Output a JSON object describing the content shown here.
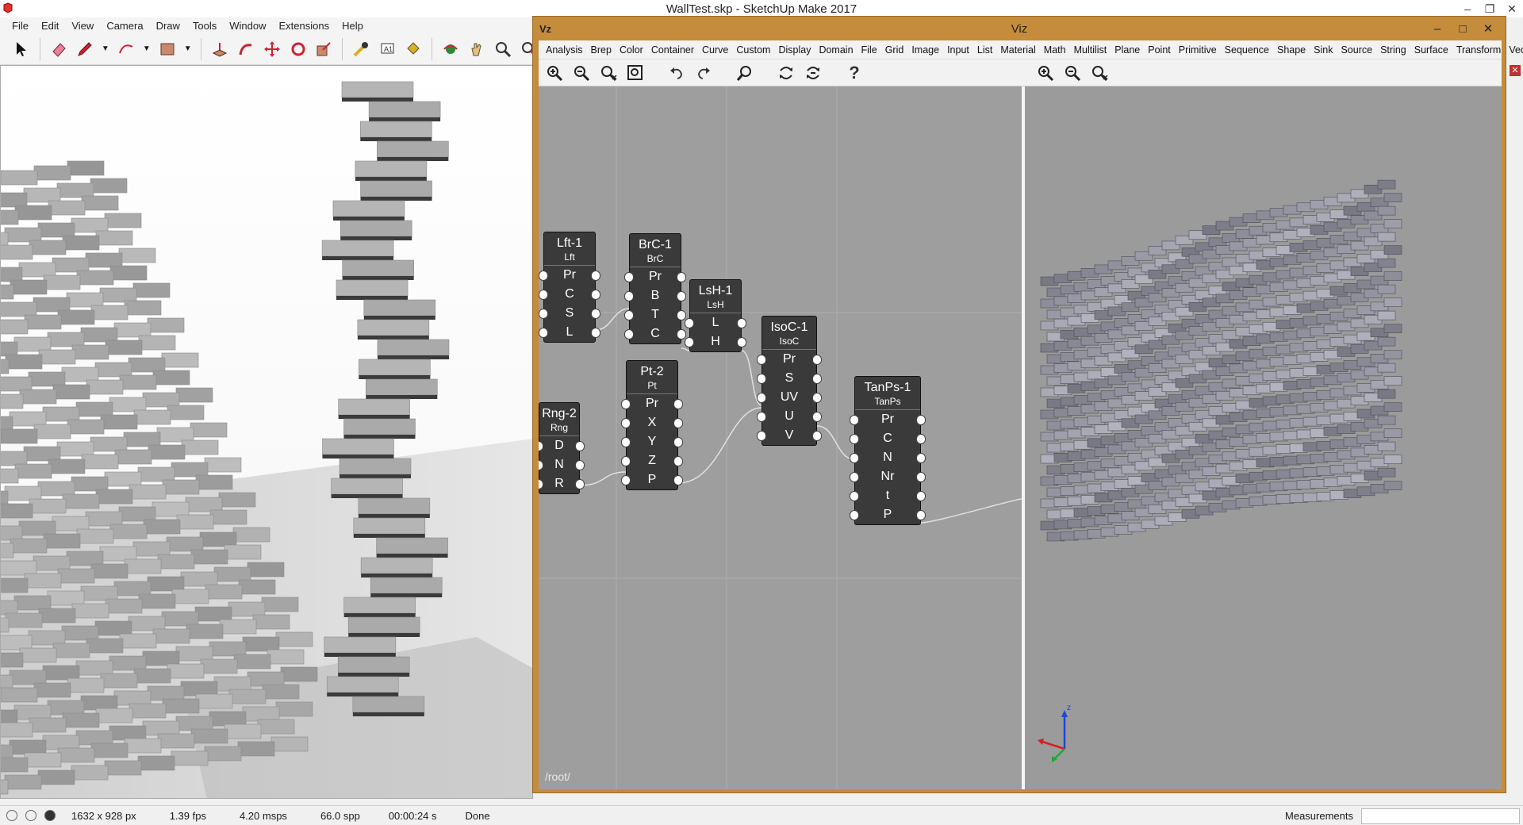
{
  "window": {
    "title": "WallTest.skp - SketchUp Make 2017"
  },
  "menu": [
    "File",
    "Edit",
    "View",
    "Camera",
    "Draw",
    "Tools",
    "Window",
    "Extensions",
    "Help"
  ],
  "toolbar_icons": [
    "select-icon",
    "eraser-icon",
    "pencil-icon",
    "arc-icon",
    "rectangle-icon",
    "pushpull-icon",
    "followme-icon",
    "move-icon",
    "rotate-icon",
    "scale-icon",
    "tape-icon",
    "text-icon",
    "paint-icon",
    "orbit-icon",
    "pan-icon",
    "zoom-icon",
    "zoom-extents-icon"
  ],
  "viz": {
    "logo": "Vz",
    "title": "Viz",
    "menu": [
      "Analysis",
      "Brep",
      "Color",
      "Container",
      "Curve",
      "Custom",
      "Display",
      "Domain",
      "File",
      "Grid",
      "Image",
      "Input",
      "List",
      "Material",
      "Math",
      "Multilist",
      "Plane",
      "Point",
      "Primitive",
      "Sequence",
      "Shape",
      "Sink",
      "Source",
      "String",
      "Surface",
      "Transform",
      "Vec"
    ],
    "root_label": "/root/",
    "help_label": "?",
    "nodes": [
      {
        "name": "Lft-1",
        "type": "Lft",
        "ports": [
          "Pr",
          "C",
          "S",
          "L"
        ]
      },
      {
        "name": "BrC-1",
        "type": "BrC",
        "ports": [
          "Pr",
          "B",
          "T",
          "C"
        ]
      },
      {
        "name": "LsH-1",
        "type": "LsH",
        "ports": [
          "L",
          "H"
        ]
      },
      {
        "name": "IsoC-1",
        "type": "IsoC",
        "ports": [
          "Pr",
          "S",
          "UV",
          "U",
          "V"
        ]
      },
      {
        "name": "Rng-2",
        "type": "Rng",
        "ports": [
          "D",
          "N",
          "R"
        ]
      },
      {
        "name": "Pt-2",
        "type": "Pt",
        "ports": [
          "Pr",
          "X",
          "Y",
          "Z",
          "P"
        ]
      },
      {
        "name": "TanPs-1",
        "type": "TanPs",
        "ports": [
          "Pr",
          "C",
          "N",
          "Nr",
          "t",
          "P"
        ]
      }
    ]
  },
  "status": {
    "resolution": "1632 x 928 px",
    "fps": "1.39 fps",
    "msps": "4.20 msps",
    "spp": "66.0 spp",
    "time": "00:00:24 s",
    "state": "Done",
    "measurements_label": "Measurements",
    "measurements_value": ""
  },
  "axes": {
    "z_label": "z"
  }
}
